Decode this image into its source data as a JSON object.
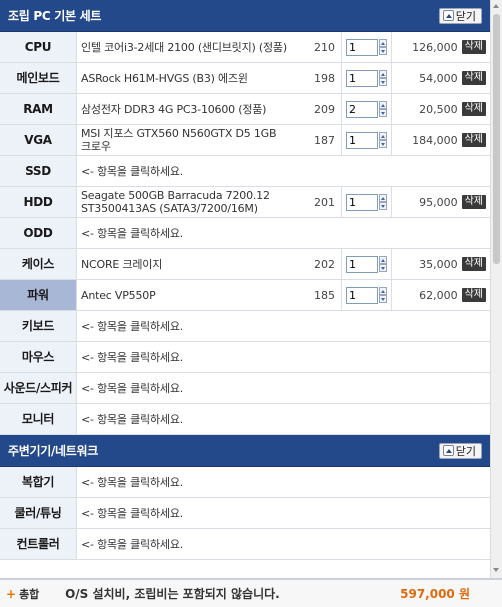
{
  "basic_set": {
    "title": "조립 PC 기본 세트",
    "collapse_label": "닫기",
    "rows": [
      {
        "category": "CPU",
        "name": "인텔 코어i3-2세대 2100 (샌디브릿지) (정품)",
        "code": "210",
        "qty": "1",
        "price": "126,000",
        "delete": "삭제",
        "active": false
      },
      {
        "category": "메인보드",
        "name": "ASRock H61M-HVGS (B3) 에즈윈",
        "code": "198",
        "qty": "1",
        "price": "54,000",
        "delete": "삭제",
        "active": false
      },
      {
        "category": "RAM",
        "name": "삼성전자 DDR3 4G PC3-10600 (정품)",
        "code": "209",
        "qty": "2",
        "price": "20,500",
        "delete": "삭제",
        "active": false
      },
      {
        "category": "VGA",
        "name": "MSI 지포스 GTX560 N560GTX D5 1GB 크로우",
        "code": "187",
        "qty": "1",
        "price": "184,000",
        "delete": "삭제",
        "active": false
      },
      {
        "category": "SSD",
        "name": "<- 항목을 클릭하세요.",
        "active": false
      },
      {
        "category": "HDD",
        "name": "Seagate 500GB Barracuda 7200.12 ST3500413AS (SATA3/7200/16M)",
        "code": "201",
        "qty": "1",
        "price": "95,000",
        "delete": "삭제",
        "active": false
      },
      {
        "category": "ODD",
        "name": "<- 항목을 클릭하세요.",
        "active": false
      },
      {
        "category": "케이스",
        "name": "NCORE 크레이지",
        "code": "202",
        "qty": "1",
        "price": "35,000",
        "delete": "삭제",
        "active": false
      },
      {
        "category": "파워",
        "name": "Antec VP550P",
        "code": "185",
        "qty": "1",
        "price": "62,000",
        "delete": "삭제",
        "active": true
      },
      {
        "category": "키보드",
        "name": "<- 항목을 클릭하세요.",
        "active": false
      },
      {
        "category": "마우스",
        "name": "<- 항목을 클릭하세요.",
        "active": false
      },
      {
        "category": "사운드/스피커",
        "name": "<- 항목을 클릭하세요.",
        "active": false
      },
      {
        "category": "모니터",
        "name": "<- 항목을 클릭하세요.",
        "active": false
      }
    ]
  },
  "peripherals": {
    "title": "주변기기/네트워크",
    "collapse_label": "닫기",
    "rows": [
      {
        "category": "복합기",
        "name": "<- 항목을 클릭하세요."
      },
      {
        "category": "쿨러/튜닝",
        "name": "<- 항목을 클릭하세요."
      },
      {
        "category": "컨트롤러",
        "name": "<- 항목을 클릭하세요."
      }
    ]
  },
  "footer": {
    "plus": "+",
    "label": "총합",
    "notice": "O/S 설치비, 조립비는 포함되지 않습니다.",
    "total": "597,000 원"
  }
}
